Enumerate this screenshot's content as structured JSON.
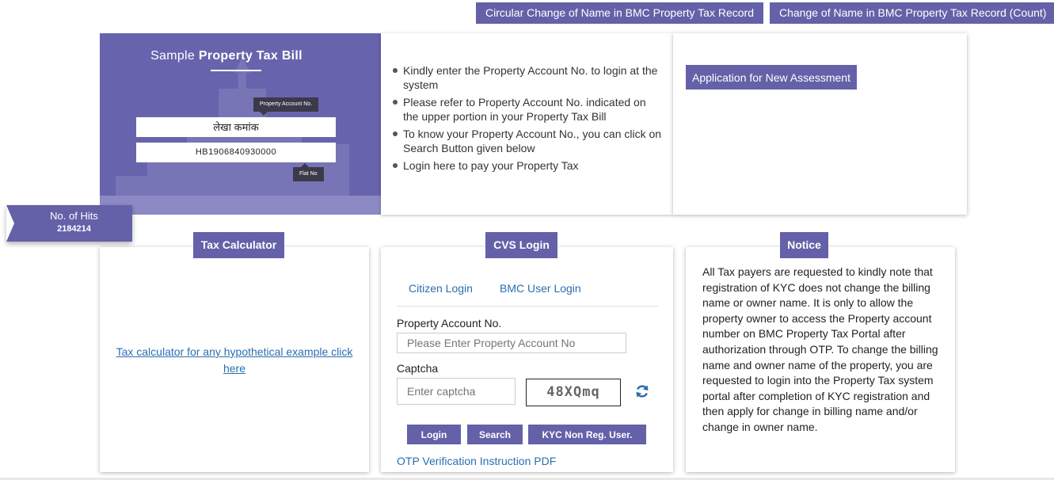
{
  "top_buttons": {
    "circular": "Circular Change of Name in BMC Property Tax Record",
    "count": "Change of Name in BMC Property Tax Record (Count)"
  },
  "sample_bill": {
    "title_prefix": "Sample ",
    "title_bold": "Property Tax Bill",
    "account_tag": "Property Account No.",
    "field_1": "लेखा कमांक",
    "field_2": "HB1906840930000",
    "flat_tag": "Flat No"
  },
  "instructions": [
    "Kindly enter the Property Account No. to login at the system",
    "Please refer to Property Account No. indicated on the upper portion in your Property Tax Bill",
    "To know your Property Account No., you can click on Search Button given below",
    "Login here to pay your Property Tax"
  ],
  "assessment": {
    "button": "Application for New Assessment"
  },
  "hits": {
    "label": "No. of Hits",
    "count": "2184214"
  },
  "tax_calculator": {
    "title": "Tax Calculator",
    "link": "Tax calculator for any hypothetical example click here"
  },
  "cvs_login": {
    "title": "CVS Login",
    "tabs": [
      "Citizen Login",
      "BMC User Login"
    ],
    "account_label": "Property Account No.",
    "account_placeholder": "Please Enter Property Account No",
    "captcha_label": "Captcha",
    "captcha_placeholder": "Enter captcha",
    "captcha_code": "48XQmq",
    "buttons": {
      "login": "Login",
      "search": "Search",
      "kyc": "KYC Non Reg. User."
    },
    "otp_link": "OTP Verification Instruction PDF"
  },
  "notice": {
    "title": "Notice",
    "text": "All Tax payers are requested to kindly note that registration of KYC does not change the billing name or owner name. It is only to allow the property owner to access the Property account number on BMC Property Tax Portal after authorization through OTP. To change the billing name and owner name of the property, you are requested to login into the Property Tax system portal after completion of KYC registration and then apply for change in billing name and/or change in owner name."
  },
  "colors": {
    "accent": "#6461a8",
    "link": "#2a6eb0"
  },
  "icons": {
    "refresh": "refresh-icon"
  }
}
